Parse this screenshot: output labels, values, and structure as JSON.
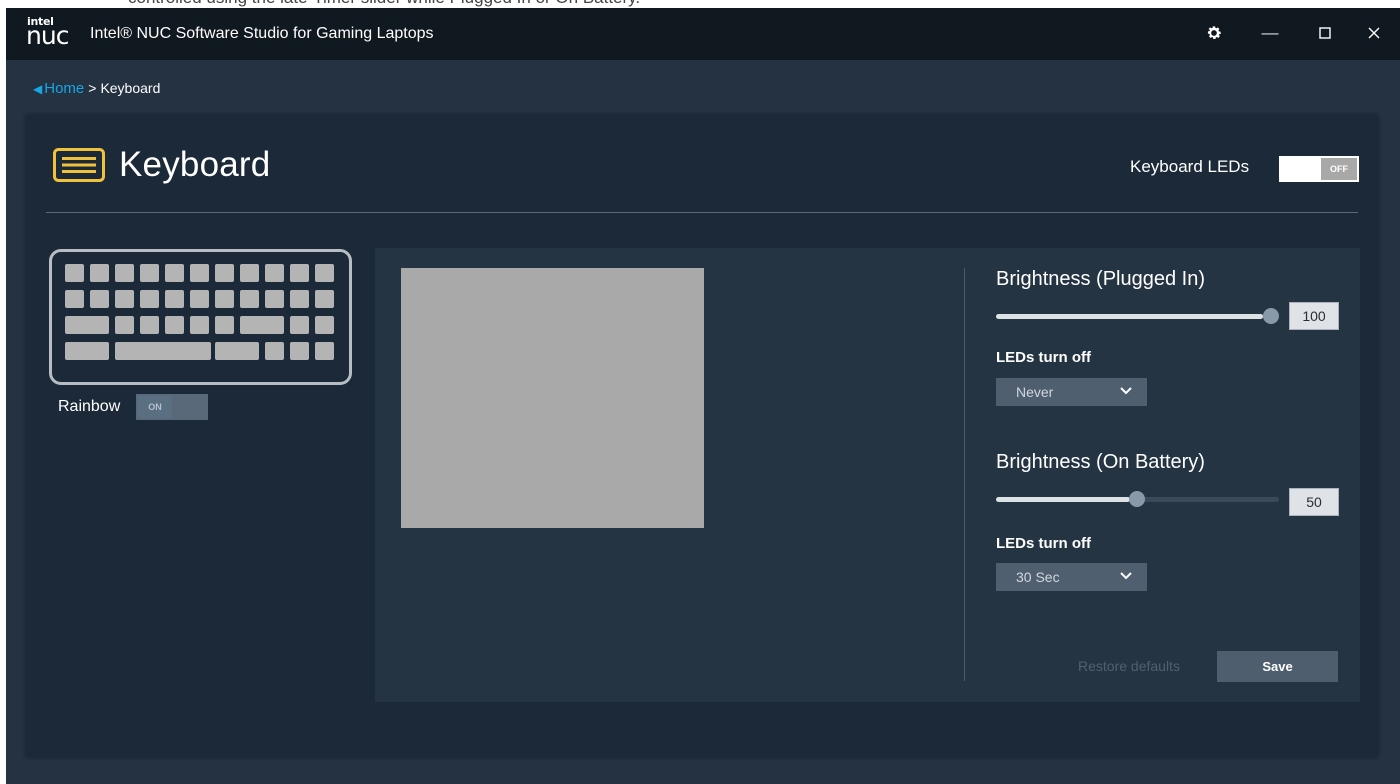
{
  "top_caption": "controlled using the late-Timer slider while Plugged In or On Battery.",
  "app": {
    "logo_small": "intel",
    "logo_large": "nuc",
    "title": "Intel® NUC Software Studio for Gaming Laptops"
  },
  "window_controls": {
    "settings_icon": "gear-icon",
    "minimize_icon": "minimize-icon",
    "maximize_icon": "maximize-icon",
    "close_icon": "close-icon",
    "minimize_glyph": "—",
    "maximize_glyph": "☐",
    "close_glyph": "✕",
    "settings_glyph": "⚙"
  },
  "breadcrumb": {
    "home": "Home",
    "separator": ">",
    "current": "Keyboard"
  },
  "page": {
    "title": "Keyboard",
    "icon_color": "#f0c23c"
  },
  "keyboard_leds": {
    "label": "Keyboard LEDs",
    "state": "OFF"
  },
  "rainbow": {
    "label": "Rainbow",
    "state": "ON"
  },
  "plugged_in": {
    "title": "Brightness (Plugged In)",
    "value": "100",
    "level": 1.0,
    "leds_turn_off_label": "LEDs turn off",
    "leds_turn_off_value": "Never"
  },
  "on_battery": {
    "title": "Brightness (On Battery)",
    "value": "50",
    "level": 0.5,
    "leds_turn_off_label": "LEDs turn off",
    "leds_turn_off_value": "30 Sec"
  },
  "actions": {
    "restore": "Restore defaults",
    "save": "Save"
  },
  "colors": {
    "accent": "#18a6e4",
    "title_bar": "#101820",
    "background": "#243241",
    "card": "#1c2938"
  }
}
